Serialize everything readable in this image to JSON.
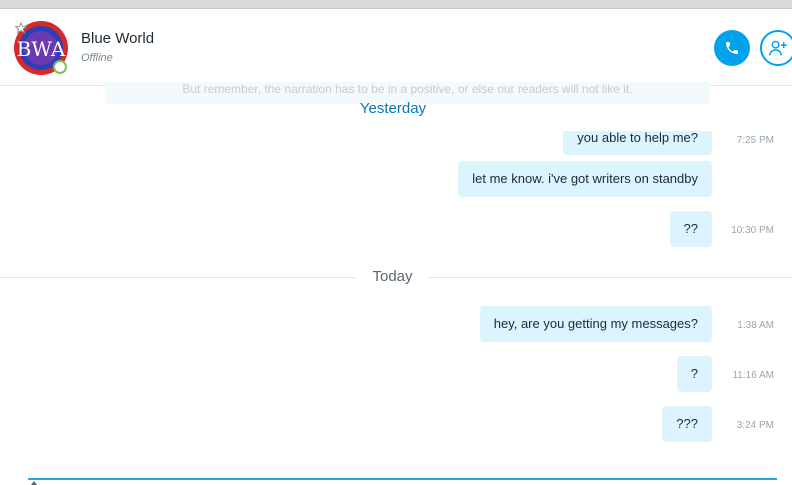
{
  "contact": {
    "name": "Blue World",
    "status": "Offline",
    "avatar_text": "BWA"
  },
  "faded_message": "But remember, the narration has to be in a positive, or else our readers will not like it.",
  "days": {
    "yesterday": "Yesterday",
    "today": "Today"
  },
  "messages": [
    {
      "text": "you able to help me?",
      "time": "7:25 PM"
    },
    {
      "text": "let me know. i've got writers on standby",
      "time": ""
    },
    {
      "text": "??",
      "time": "10:30 PM"
    },
    {
      "text": "hey, are you getting my messages?",
      "time": "1:38 AM"
    },
    {
      "text": "?",
      "time": "11:16 AM"
    },
    {
      "text": "???",
      "time": "3:24 PM"
    }
  ],
  "icons": {
    "call": "phone-icon",
    "add_person": "add-person-icon",
    "favorite": "star-icon"
  },
  "colors": {
    "accent": "#00a2ed",
    "bubble": "#dcf4fd",
    "presence": "#7fbf5a"
  }
}
